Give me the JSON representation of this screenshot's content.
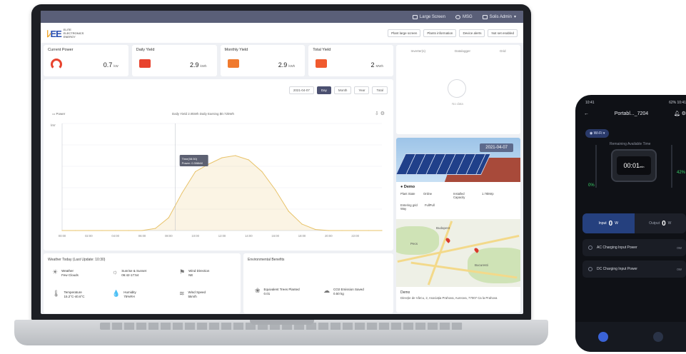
{
  "topbar": {
    "large_screen": "Large Screen",
    "msg": "MSG",
    "user": "Solis Admin"
  },
  "header": {
    "logo_mark": "EE",
    "logo_sub1": "ELITE",
    "logo_sub2": "ELECTRONICS",
    "logo_sub3": "ENERGY",
    "buttons": [
      "Plant large screen",
      "Plants information",
      "Device alerts",
      "Not set enabled"
    ]
  },
  "stats": [
    {
      "label": "Current Power",
      "value": "0.7",
      "unit": "kW"
    },
    {
      "label": "Daily Yield",
      "value": "2.9",
      "unit": "kWh"
    },
    {
      "label": "Monthly Yield",
      "value": "2.9",
      "unit": "kWh"
    },
    {
      "label": "Total Yield",
      "value": "2",
      "unit": "MWh"
    }
  ],
  "weather_side": {
    "tabs": [
      "Inverter(s)",
      "Datalogger",
      "Grid"
    ],
    "empty": "No data"
  },
  "chart_toolbar": {
    "date": "2021-04-07",
    "periods": [
      "Day",
      "Month",
      "Year",
      "Total"
    ],
    "active": "Day"
  },
  "chart_legend": {
    "series": "Power",
    "summary": "Daily Yield  2.9kWh    Daily Earning  $0.72kWh"
  },
  "chart_tooltip": {
    "time": "Time(08:30)",
    "value": "Power: 0.308kW"
  },
  "chart_data": {
    "type": "area",
    "title": "",
    "xlabel": "",
    "ylabel": "kW",
    "x": [
      "00:00",
      "01:00",
      "02:00",
      "03:00",
      "04:00",
      "05:00",
      "06:00",
      "07:00",
      "08:00",
      "09:00",
      "10:00",
      "11:00",
      "12:00",
      "13:00",
      "14:00",
      "15:00",
      "16:00",
      "17:00",
      "18:00",
      "19:00",
      "20:00",
      "21:00",
      "22:00",
      "23:00",
      "24:00"
    ],
    "series": [
      {
        "name": "Power",
        "values": [
          0,
          0,
          0,
          0,
          0,
          0,
          0,
          0.02,
          0.12,
          0.35,
          0.55,
          0.62,
          0.68,
          0.7,
          0.66,
          0.55,
          0.38,
          0.18,
          0.06,
          0.01,
          0,
          0,
          0,
          0,
          0
        ]
      }
    ],
    "ylim": [
      0,
      1
    ],
    "xtick_labels": [
      "00:00",
      "02:00",
      "04:00",
      "06:00",
      "08:00",
      "10:00",
      "12:00",
      "14:00",
      "16:00",
      "18:00",
      "20:00",
      "22:00"
    ],
    "grid": true,
    "color": "#e8c36a"
  },
  "weather_panel": {
    "title": "Weather Today (Last Update: 10:30)",
    "items": [
      {
        "icon": "weather-icon",
        "glyph": "☀",
        "label": "Weather",
        "value": "Few Clouds"
      },
      {
        "icon": "sunrise-icon",
        "glyph": "☼",
        "label": "Sunrise & Sunset",
        "value": "06:42-17:54"
      },
      {
        "icon": "wind-direction-icon",
        "glyph": "⚑",
        "label": "Wind Direction",
        "value": "NE"
      },
      {
        "icon": "temperature-icon",
        "glyph": "🌡",
        "label": "Temperature",
        "value": "15.2°C-40.6°C"
      },
      {
        "icon": "humidity-icon",
        "glyph": "💧",
        "label": "Humidity",
        "value": "75%RH"
      },
      {
        "icon": "wind-speed-icon",
        "glyph": "≋",
        "label": "Wind Speed",
        "value": "5km/h"
      }
    ]
  },
  "env_panel": {
    "title": "Environmental Benefits",
    "items": [
      {
        "icon": "tree-icon",
        "glyph": "❀",
        "label": "Equivalent Trees Planted",
        "value": "0.01"
      },
      {
        "icon": "cloud-icon",
        "glyph": "☁",
        "label": "CO2 Emission Saved",
        "value": "0.50 kg"
      }
    ]
  },
  "plant": {
    "date": "2021-04-07",
    "name": "Demo",
    "state_label": "Plant State",
    "state_value": "Online",
    "capacity_label": "Installed Capacity",
    "capacity_value": "1.76kWp",
    "grid_label": "Entering grid Way",
    "grid_value": "FullPull",
    "desc_title": "Demo",
    "desc": "Direcție de Vârcu, 2, Asociația Prahova, Aurecea, 77007 Ca la Prahova",
    "map_labels": [
      "Budapest",
      "Pecs",
      "Bucuresti"
    ]
  },
  "phone": {
    "time": "10:41",
    "status_right": "62% 10:41",
    "title": "Portabl..._7204",
    "wifi": "Wi-Fi",
    "remain": "Remaining Available Time",
    "display": "00:01",
    "display_unit": "min",
    "pct_left": "0%",
    "pct_right": "42%",
    "input_label": "Input",
    "input_value": "0",
    "input_unit": "W",
    "output_label": "Output",
    "output_value": "0",
    "output_unit": "W",
    "rows": [
      {
        "label": "AC Charging Input Power",
        "value": "0W"
      },
      {
        "label": "DC Charging Input Power",
        "value": "0W"
      }
    ]
  }
}
